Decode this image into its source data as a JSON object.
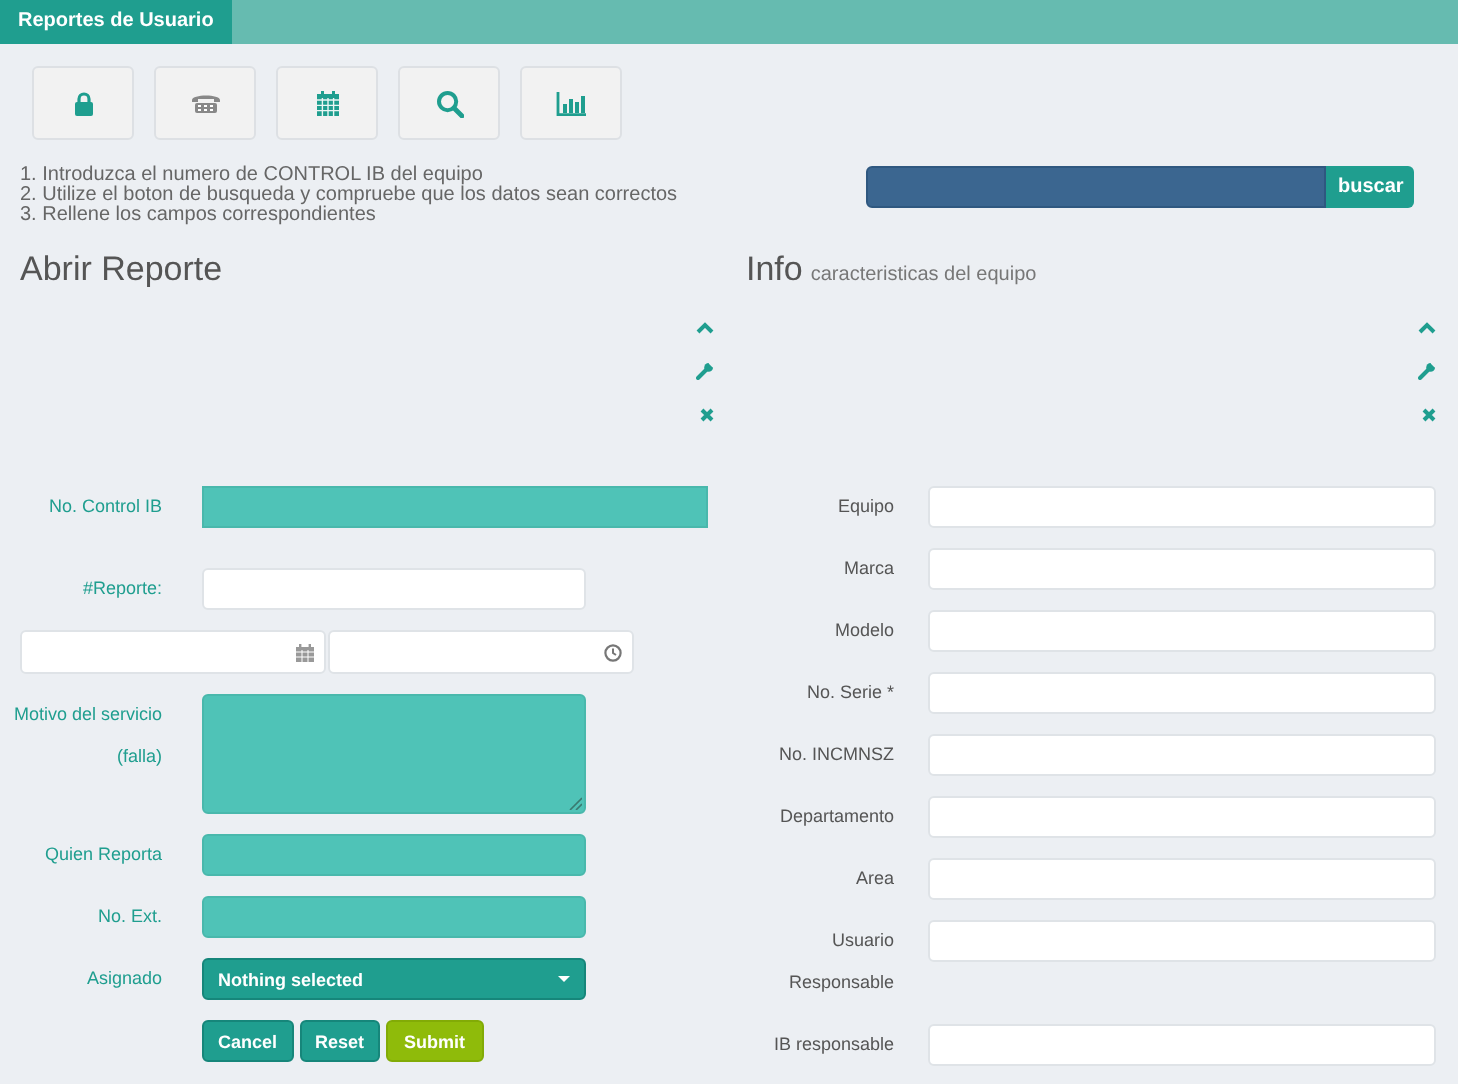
{
  "header": {
    "tab": "Reportes de Usuario"
  },
  "toolbar": [
    {
      "kind": "lock"
    },
    {
      "kind": "phone"
    },
    {
      "kind": "calendar"
    },
    {
      "kind": "search"
    },
    {
      "kind": "chart"
    }
  ],
  "instructions": [
    "1. Introduzca el numero de CONTROL IB del equipo",
    "2. Utilize el boton de busqueda y compruebe que los datos sean correctos",
    "3. Rellene los campos correspondientes"
  ],
  "search": {
    "button": "buscar"
  },
  "report_panel": {
    "title": "Abrir Reporte",
    "fields": [
      {
        "kind": "text",
        "label": [
          "No. Control IB"
        ],
        "highlighted": true,
        "wide": true
      },
      {
        "kind": "text",
        "label": [
          "#Reporte:"
        ],
        "highlighted": false,
        "wide": false
      },
      {
        "kind": "datetime"
      },
      {
        "kind": "textarea",
        "label": [
          "Motivo del servicio",
          "(falla)"
        ],
        "highlighted": true
      },
      {
        "kind": "text",
        "label": [
          "Quien Reporta"
        ],
        "highlighted": true,
        "wide": false
      },
      {
        "kind": "text",
        "label": [
          "No. Ext."
        ],
        "highlighted": true,
        "wide": false
      },
      {
        "kind": "select",
        "label": [
          "Asignado"
        ],
        "value": "Nothing selected"
      }
    ],
    "buttons": [
      {
        "label": "Cancel",
        "kind": "default"
      },
      {
        "label": "Reset",
        "kind": "default"
      },
      {
        "label": "Submit",
        "kind": "success"
      }
    ]
  },
  "info_panel": {
    "title": "Info",
    "subtitle": "caracteristicas del equipo",
    "fields": [
      {
        "label": [
          "Equipo"
        ]
      },
      {
        "label": [
          "Marca"
        ]
      },
      {
        "label": [
          "Modelo"
        ]
      },
      {
        "label": [
          "No. Serie *"
        ]
      },
      {
        "label": [
          "No. INCMNSZ"
        ]
      },
      {
        "label": [
          "Departamento"
        ]
      },
      {
        "label": [
          "Area"
        ]
      },
      {
        "label": [
          "Usuario",
          "Responsable"
        ]
      },
      {
        "label": [
          "IB responsable"
        ]
      }
    ]
  }
}
